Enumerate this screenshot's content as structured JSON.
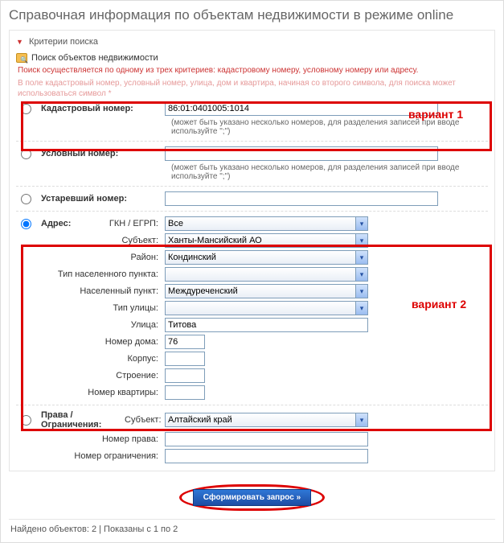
{
  "page_title": "Справочная информация по объектам недвижимости в режиме online",
  "panel_title": "Критерии поиска",
  "section_title": "Поиск объектов недвижимости",
  "note1": "Поиск осуществляется по одному из трех критериев: кадастровому номеру, условному номеру или адресу.",
  "note2": "В поле кадастровый номер, условный номер, улица, дом и квартира, начиная со второго символа, для поиска может использоваться символ *",
  "labels": {
    "cadastral": "Кадастровый номер:",
    "conditional": "Условный номер:",
    "old": "Устаревший номер:",
    "address": "Адрес:",
    "gkn": "ГКН / ЕГРП:",
    "subject": "Субъект:",
    "district": "Район:",
    "settlement_type": "Тип населенного пункта:",
    "settlement": "Населенный пункт:",
    "street_type": "Тип улицы:",
    "street": "Улица:",
    "house": "Номер дома:",
    "corp": "Корпус:",
    "building": "Строение:",
    "flat": "Номер квартиры:",
    "rights": "Права / Ограничения:",
    "right_no": "Номер права:",
    "restriction_no": "Номер ограничения:"
  },
  "values": {
    "cadastral": "86:01:0401005:1014",
    "gkn": "Все",
    "subject": "Ханты-Мансийский АО",
    "district": "Кондинский",
    "settlement": "Междуреченский",
    "street": "Титова",
    "house": "76",
    "rights_subject": "Алтайский край"
  },
  "hints": {
    "multi": "(может быть указано несколько номеров, для разделения записей при вводе используйте \";\")"
  },
  "variants": {
    "v1": "вариант 1",
    "v2": "вариант 2"
  },
  "submit_label": "Сформировать запрос »",
  "footer_left": "Найдено объектов: 2 | Показаны с 1 по 2"
}
